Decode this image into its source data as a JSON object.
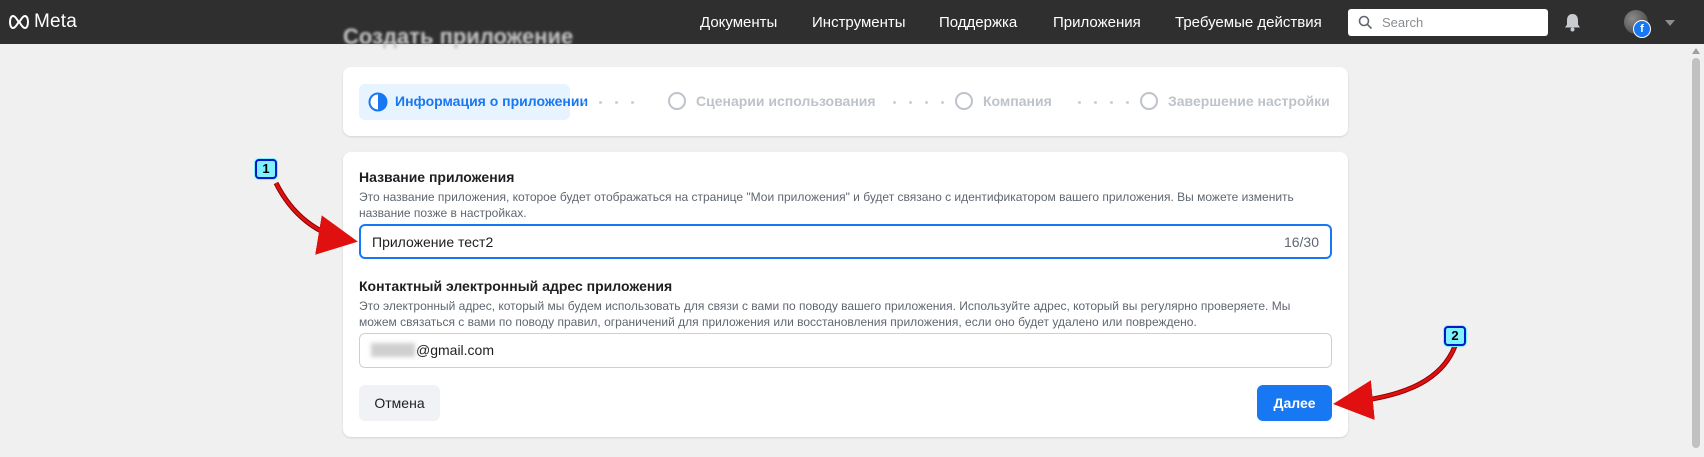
{
  "topbar": {
    "logo_text": "Meta",
    "nav": [
      "Документы",
      "Инструменты",
      "Поддержка",
      "Приложения",
      "Требуемые действия"
    ],
    "search_placeholder": "Search",
    "badge_letter": "f"
  },
  "page_title": "Создать приложение",
  "stepper": {
    "steps": [
      {
        "label": "Информация о приложении",
        "state": "active"
      },
      {
        "label": "Сценарии использования",
        "state": "pending"
      },
      {
        "label": "Компания",
        "state": "pending"
      },
      {
        "label": "Завершение настройки",
        "state": "pending"
      }
    ]
  },
  "form": {
    "app_name": {
      "title": "Название приложения",
      "description": "Это название приложения, которое будет отображаться на странице \"Мои приложения\" и будет связано с идентификатором вашего приложения. Вы можете изменить название позже в настройках.",
      "value": "Приложение тест2",
      "counter": "16/30"
    },
    "email": {
      "title": "Контактный электронный адрес приложения",
      "description": "Это электронный адрес, который мы будем использовать для связи с вами по поводу вашего приложения. Используйте адрес, который вы регулярно проверяете. Мы можем связаться с вами по поводу правил, ограничений для приложения или восстановления приложения, если оно будет удалено или повреждено.",
      "value_visible": "@gmail.com"
    },
    "cancel_label": "Отмена",
    "next_label": "Далее"
  },
  "annotations": [
    "1",
    "2"
  ],
  "colors": {
    "accent": "#1877f2",
    "topbar": "#2f2f2f",
    "arrow": "#e01010",
    "marker_fill": "#7ef2ff",
    "marker_border": "#0019c9"
  }
}
